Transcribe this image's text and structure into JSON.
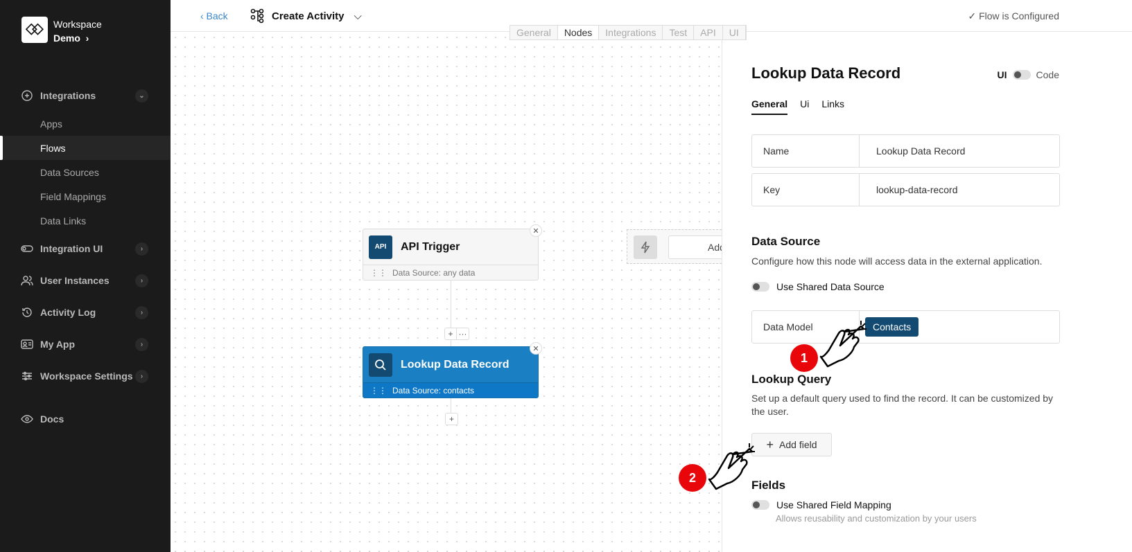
{
  "workspace": {
    "name": "Workspace",
    "sub": "Demo"
  },
  "sidebar": {
    "items": [
      {
        "label": "Integrations",
        "type": "main",
        "icon": "plus-circle-icon",
        "expanded": true
      },
      {
        "label": "Apps",
        "type": "sub"
      },
      {
        "label": "Flows",
        "type": "sub",
        "active": true
      },
      {
        "label": "Data Sources",
        "type": "sub"
      },
      {
        "label": "Field Mappings",
        "type": "sub"
      },
      {
        "label": "Data Links",
        "type": "sub"
      },
      {
        "label": "Integration UI",
        "type": "main",
        "icon": "toggle-icon"
      },
      {
        "label": "User Instances",
        "type": "main",
        "icon": "users-icon"
      },
      {
        "label": "Activity Log",
        "type": "main",
        "icon": "history-icon"
      },
      {
        "label": "My App",
        "type": "main",
        "icon": "id-card-icon"
      },
      {
        "label": "Workspace Settings",
        "type": "main",
        "icon": "sliders-icon"
      },
      {
        "label": "Docs",
        "type": "main",
        "icon": "eye-icon"
      }
    ]
  },
  "header": {
    "back": "‹ Back",
    "title": "Create Activity",
    "status": "Flow is Configured",
    "tabs": [
      "General",
      "Nodes",
      "Integrations",
      "Test",
      "API",
      "UI"
    ],
    "active_tab": "Nodes"
  },
  "canvas": {
    "nodes": [
      {
        "badge": "API",
        "title": "API Trigger",
        "source": "Data Source: any data"
      },
      {
        "badge": "search-icon",
        "title": "Lookup Data Record",
        "source": "Data Source: contacts",
        "selected": true
      }
    ],
    "ghost_label": "Add"
  },
  "panel": {
    "title": "Lookup Data Record",
    "mode_ui": "UI",
    "mode_code": "Code",
    "tabs": [
      "General",
      "Ui",
      "Links"
    ],
    "name_label": "Name",
    "name_value": "Lookup Data Record",
    "key_label": "Key",
    "key_value": "lookup-data-record",
    "ds_title": "Data Source",
    "ds_desc": "Configure how this node will access data in the external application.",
    "ds_shared": "Use Shared Data Source",
    "dm_label": "Data Model",
    "dm_value": "Contacts",
    "lq_title": "Lookup Query",
    "lq_desc": "Set up a default query used to find the record. It can be customized by the user.",
    "add_field": "Add field",
    "fields_title": "Fields",
    "fields_shared": "Use Shared Field Mapping",
    "fields_hint": "Allows reusability and customization by your users"
  },
  "annotations": [
    "1",
    "2"
  ],
  "colors": {
    "accent": "#1a7fc3",
    "dark_badge": "#124a72",
    "annotation": "#e8060a"
  }
}
